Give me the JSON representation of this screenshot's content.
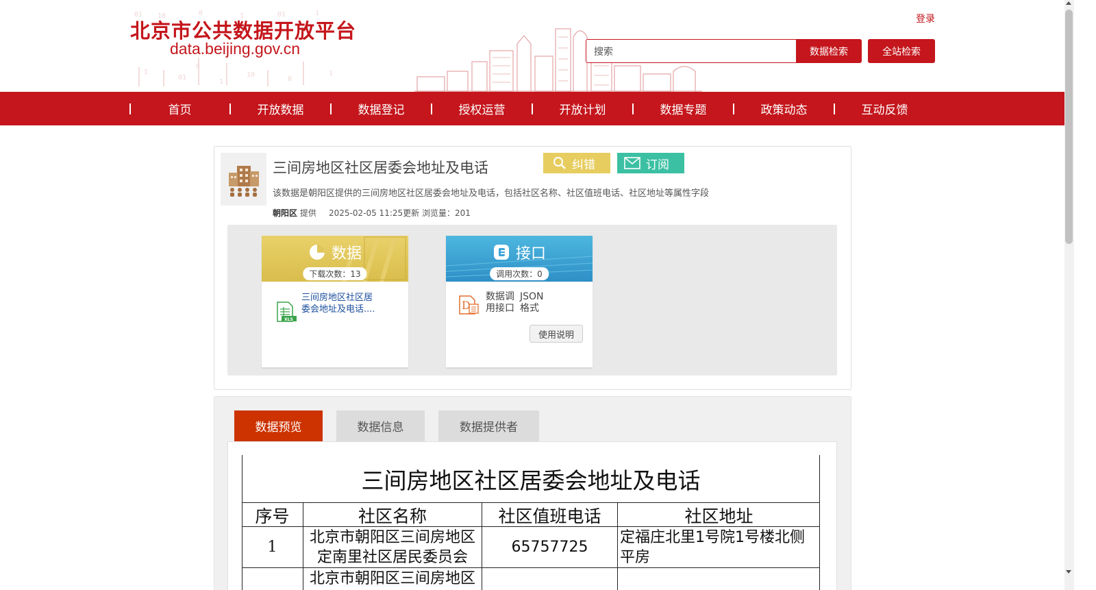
{
  "header": {
    "site_title": "北京市公共数据开放平台",
    "site_url": "data.beijing.gov.cn",
    "login_label": "登录",
    "search_placeholder": "搜索",
    "data_search_label": "数据检索",
    "site_search_label": "全站检索"
  },
  "nav": {
    "items": [
      {
        "label": "首页"
      },
      {
        "label": "开放数据"
      },
      {
        "label": "数据登记"
      },
      {
        "label": "授权运营"
      },
      {
        "label": "开放计划"
      },
      {
        "label": "数据专题"
      },
      {
        "label": "政策动态"
      },
      {
        "label": "互动反馈"
      }
    ]
  },
  "dataset": {
    "title": "三间房地区社区居委会地址及电话",
    "correct_label": "纠错",
    "subscribe_label": "订阅",
    "description": "该数据是朝阳区提供的三间房地区社区居委会地址及电话，包括社区名称、社区值班电话、社区地址等属性字段",
    "provider": "朝阳区",
    "provider_suffix": "提供",
    "updated": "2025-02-05 11:25更新",
    "views": "浏览量：201"
  },
  "resources": {
    "data": {
      "title": "数据",
      "count": "下载次数：13",
      "file_name": "三间房地区社区居委会地址及电话....",
      "file_icon": "xls-file-icon"
    },
    "api": {
      "title": "接口",
      "count": "调用次数：0",
      "name": "数据调用接口",
      "format": "JSON格式",
      "usage_label": "使用说明"
    }
  },
  "tabs": [
    {
      "label": "数据预览",
      "active": true
    },
    {
      "label": "数据信息",
      "active": false
    },
    {
      "label": "数据提供者",
      "active": false
    }
  ],
  "preview": {
    "sheet_title": "三间房地区社区居委会地址及电话",
    "headers": [
      "序号",
      "社区名称",
      "社区值班电话",
      "社区地址"
    ],
    "rows": [
      [
        "1",
        "北京市朝阳区三间房地区定南里社区居民委员会",
        "65757725",
        "定福庄北里1号院1号楼北侧平房"
      ],
      [
        "",
        "北京市朝阳区三间房地区",
        "",
        ""
      ]
    ]
  },
  "colors": {
    "brand_red": "#c4161c",
    "correct_yellow": "#e7cd5f",
    "subscribe_green": "#3cc0a3",
    "active_tab": "#cc3300"
  }
}
